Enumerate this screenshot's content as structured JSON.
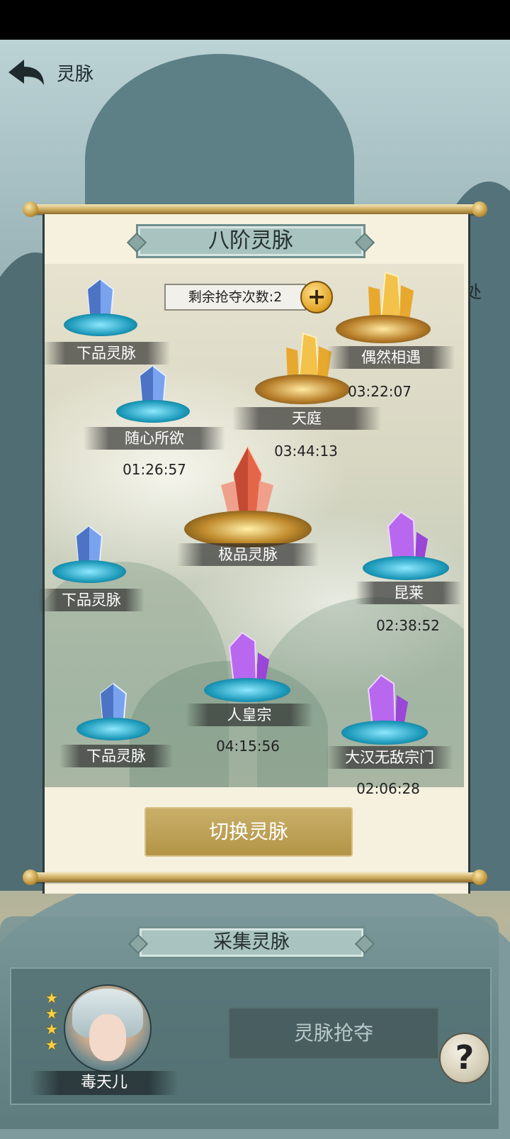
{
  "header": {
    "title": "灵脉",
    "side_text": "处"
  },
  "panel": {
    "title": "八阶灵脉",
    "counter_label": "剩余抢夺次数:2",
    "plus_symbol": "+",
    "switch_label": "切换灵脉"
  },
  "nodes": [
    {
      "label": "下品灵脉",
      "timer": "",
      "tier": "blue"
    },
    {
      "label": "随心所欲",
      "timer": "01:26:57",
      "tier": "blue"
    },
    {
      "label": "天庭",
      "timer": "03:44:13",
      "tier": "gold"
    },
    {
      "label": "偶然相遇",
      "timer": "03:22:07",
      "tier": "gold"
    },
    {
      "label": "极品灵脉",
      "timer": "",
      "tier": "supreme"
    },
    {
      "label": "下品灵脉",
      "timer": "",
      "tier": "blue"
    },
    {
      "label": "昆莱",
      "timer": "02:38:52",
      "tier": "purple"
    },
    {
      "label": "人皇宗",
      "timer": "04:15:56",
      "tier": "purple"
    },
    {
      "label": "下品灵脉",
      "timer": "",
      "tier": "blue"
    },
    {
      "label": "大汉无敌宗门",
      "timer": "02:06:28",
      "tier": "purple"
    }
  ],
  "bottom": {
    "title": "采集灵脉",
    "hero_name": "毒天儿",
    "hero_stars": 4,
    "grab_label": "灵脉抢夺",
    "help_symbol": "?"
  },
  "colors": {
    "blue_crystal": "#5a8fe0",
    "gold_crystal": "#e8b23a",
    "purple_crystal": "#b05ae6",
    "supreme_crystal": "#e4664a",
    "button_gold": "#bfa45a",
    "ribbon": "#a8c3c0"
  }
}
